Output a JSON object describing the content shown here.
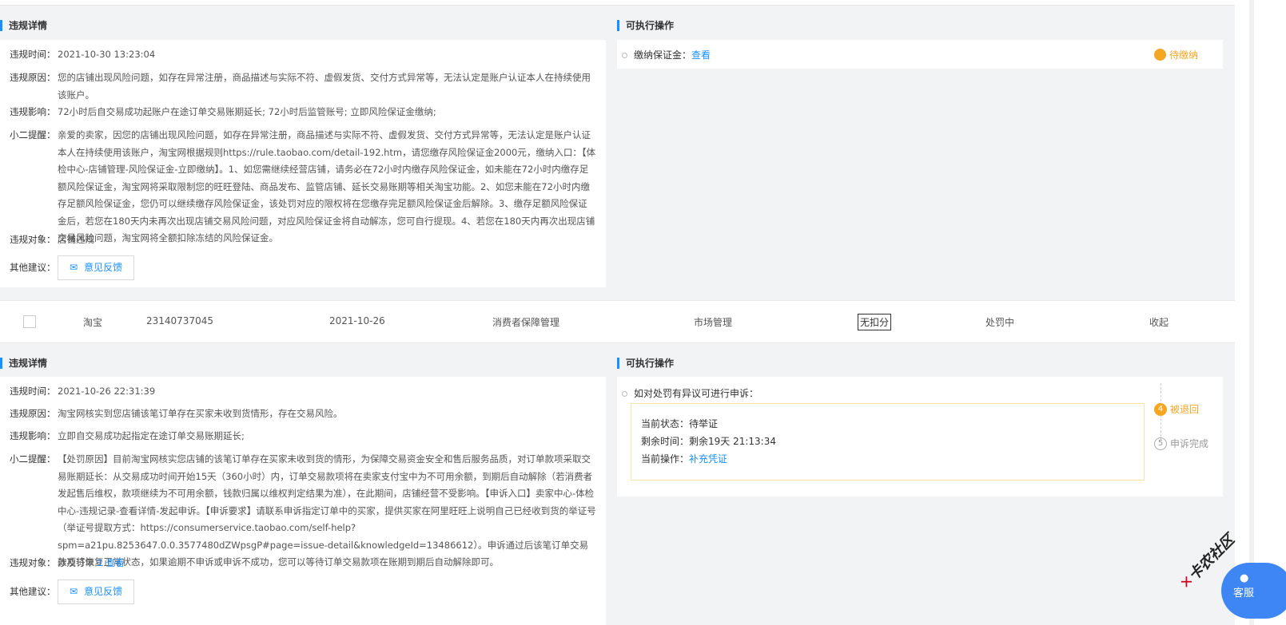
{
  "block1": {
    "detail_title": "违规详情",
    "actions_title": "可执行操作",
    "fields": [
      {
        "label": "违规时间：",
        "value": "2021-10-30 13:23:04"
      },
      {
        "label": "违规原因：",
        "value": "您的店铺出现风险问题，如存在异常注册，商品描述与实际不符、虚假发货、交付方式异常等，无法认定是账户认证本人在持续使用该账户。"
      },
      {
        "label": "违规影响：",
        "value": "72小时后自交易成功起账户在途订单交易账期延长; 72小时后监管账号; 立即风险保证金缴纳;"
      },
      {
        "label": "小二提醒：",
        "value": "亲爱的卖家，因您的店铺出现风险问题，如存在异常注册，商品描述与实际不符、虚假发货、交付方式异常等，无法认定是账户认证本人在持续使用该账户，淘宝网根据规则https://rule.taobao.com/detail-192.htm，请您缴存风险保证金2000元，缴纳入口：【体检中心-店铺管理-风险保证金-立即缴纳】。1、如您需继续经营店铺，请务必在72小时内缴存风险保证金，如未能在72小时内缴存足额风险保证金，淘宝网将采取限制您的旺旺登陆、商品发布、监管店铺、延长交易账期等相关淘宝功能。2、如您未能在72小时内缴存足额风险保证金，您仍可以继续缴存风险保证金，该处罚对应的限权将在您缴存完足额风险保证金后解除。3、缴存足额风险保证金后，若您在180天内未再次出现店铺交易风险问题，对应风险保证金将自动解冻，您可自行提现。4、若您在180天内再次出现店铺交易风险问题，淘宝网将全额扣除冻结的风险保证金。"
      },
      {
        "label": "违规对象：",
        "value": "店铺违规"
      }
    ],
    "other_label": "其他建议：",
    "feedback": "意见反馈",
    "action_text": "缴纳保证金：",
    "action_link": "查看",
    "status": "待缴纳",
    "status_color": "#f5a623"
  },
  "row": {
    "platform": "淘宝",
    "id": "23140737045",
    "date": "2021-10-26",
    "type": "消费者保障管理",
    "category": "市场管理",
    "deduction": "无扣分",
    "state": "处罚中",
    "toggle": "收起"
  },
  "block2": {
    "detail_title": "违规详情",
    "actions_title": "可执行操作",
    "fields": [
      {
        "label": "违规时间：",
        "value": "2021-10-26 22:31:39"
      },
      {
        "label": "违规原因：",
        "value": "淘宝网核实到您店铺该笔订单存在买家未收到货情形，存在交易风险。"
      },
      {
        "label": "违规影响：",
        "value": "立即自交易成功起指定在途订单交易账期延长;"
      },
      {
        "label": "小二提醒：",
        "value": "【处罚原因】目前淘宝网核实您店铺的该笔订单存在买家未收到货的情形，为保障交易资金安全和售后服务品质，对订单款项采取交易账期延长：从交易成功时间开始15天（360小时）内，订单交易款项将在卖家支付宝中为不可用余额，到期后自动解除（若消费者发起售后维权，款项继续为不可用余额，钱款归属以维权判定结果为准），在此期间，店铺经营不受影响。【申诉入口】卖家中心-体检中心-违规记录-查看详情-发起申诉。【申诉要求】请联系申诉指定订单中的买家，提供买家在阿里旺旺上说明自己已经收到货的举证号（举证号提取方式：https://consumerservice.taobao.com/self-help?spm=a21pu.8253647.0.0.3577480dZWpsgP#page=issue-detail&knowledgeId=13486612）。申诉通过后该笔订单交易款项将恢复正常状态，如果逾期不申诉或申诉不成功，您可以等待订单交易款项在账期到期后自动解除即可。"
      }
    ],
    "object_label": "违规对象：",
    "object_value": "涉及订单",
    "object_count": "1",
    "object_link": "查看",
    "other_label": "其他建议：",
    "feedback": "意见反馈",
    "appeal_title": "如对处罚有异议可进行申诉：",
    "status_label": "当前状态：",
    "status_value": "待举证",
    "remain_label": "剩余时间：",
    "remain_value": "剩余19天 21:13:34",
    "op_label": "当前操作：",
    "op_link": "补充凭证",
    "steps": [
      {
        "num": "4",
        "label": "被退回",
        "active": true
      },
      {
        "num": "5",
        "label": "申诉完成",
        "active": false
      }
    ]
  },
  "float": {
    "service": "客服",
    "watermark": "卡农社区"
  }
}
